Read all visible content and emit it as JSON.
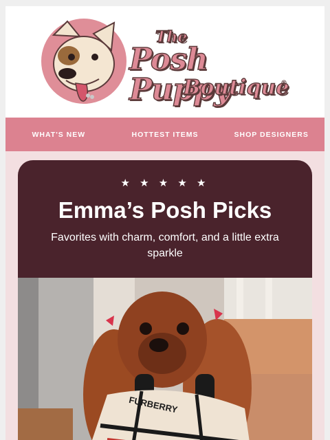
{
  "brand": {
    "logo_the": "The",
    "logo_posh_puppy": "Posh Puppy",
    "logo_boutique": "Boutique",
    "logo_registered": "®"
  },
  "nav": [
    {
      "label": "WHAT'S NEW"
    },
    {
      "label": "HOTTEST ITEMS"
    },
    {
      "label": "SHOP DESIGNERS"
    }
  ],
  "feature": {
    "stars": "★ ★ ★ ★ ★",
    "rating": 5,
    "title": "Emma’s Posh Picks",
    "subtitle": "Favorites with charm, comfort, and a little extra sparkle",
    "toy_text": "FURBERRY"
  },
  "colors": {
    "brand_pink": "#dc8290",
    "feature_maroon": "#4a232c",
    "page_blush": "#f3dfe1"
  }
}
